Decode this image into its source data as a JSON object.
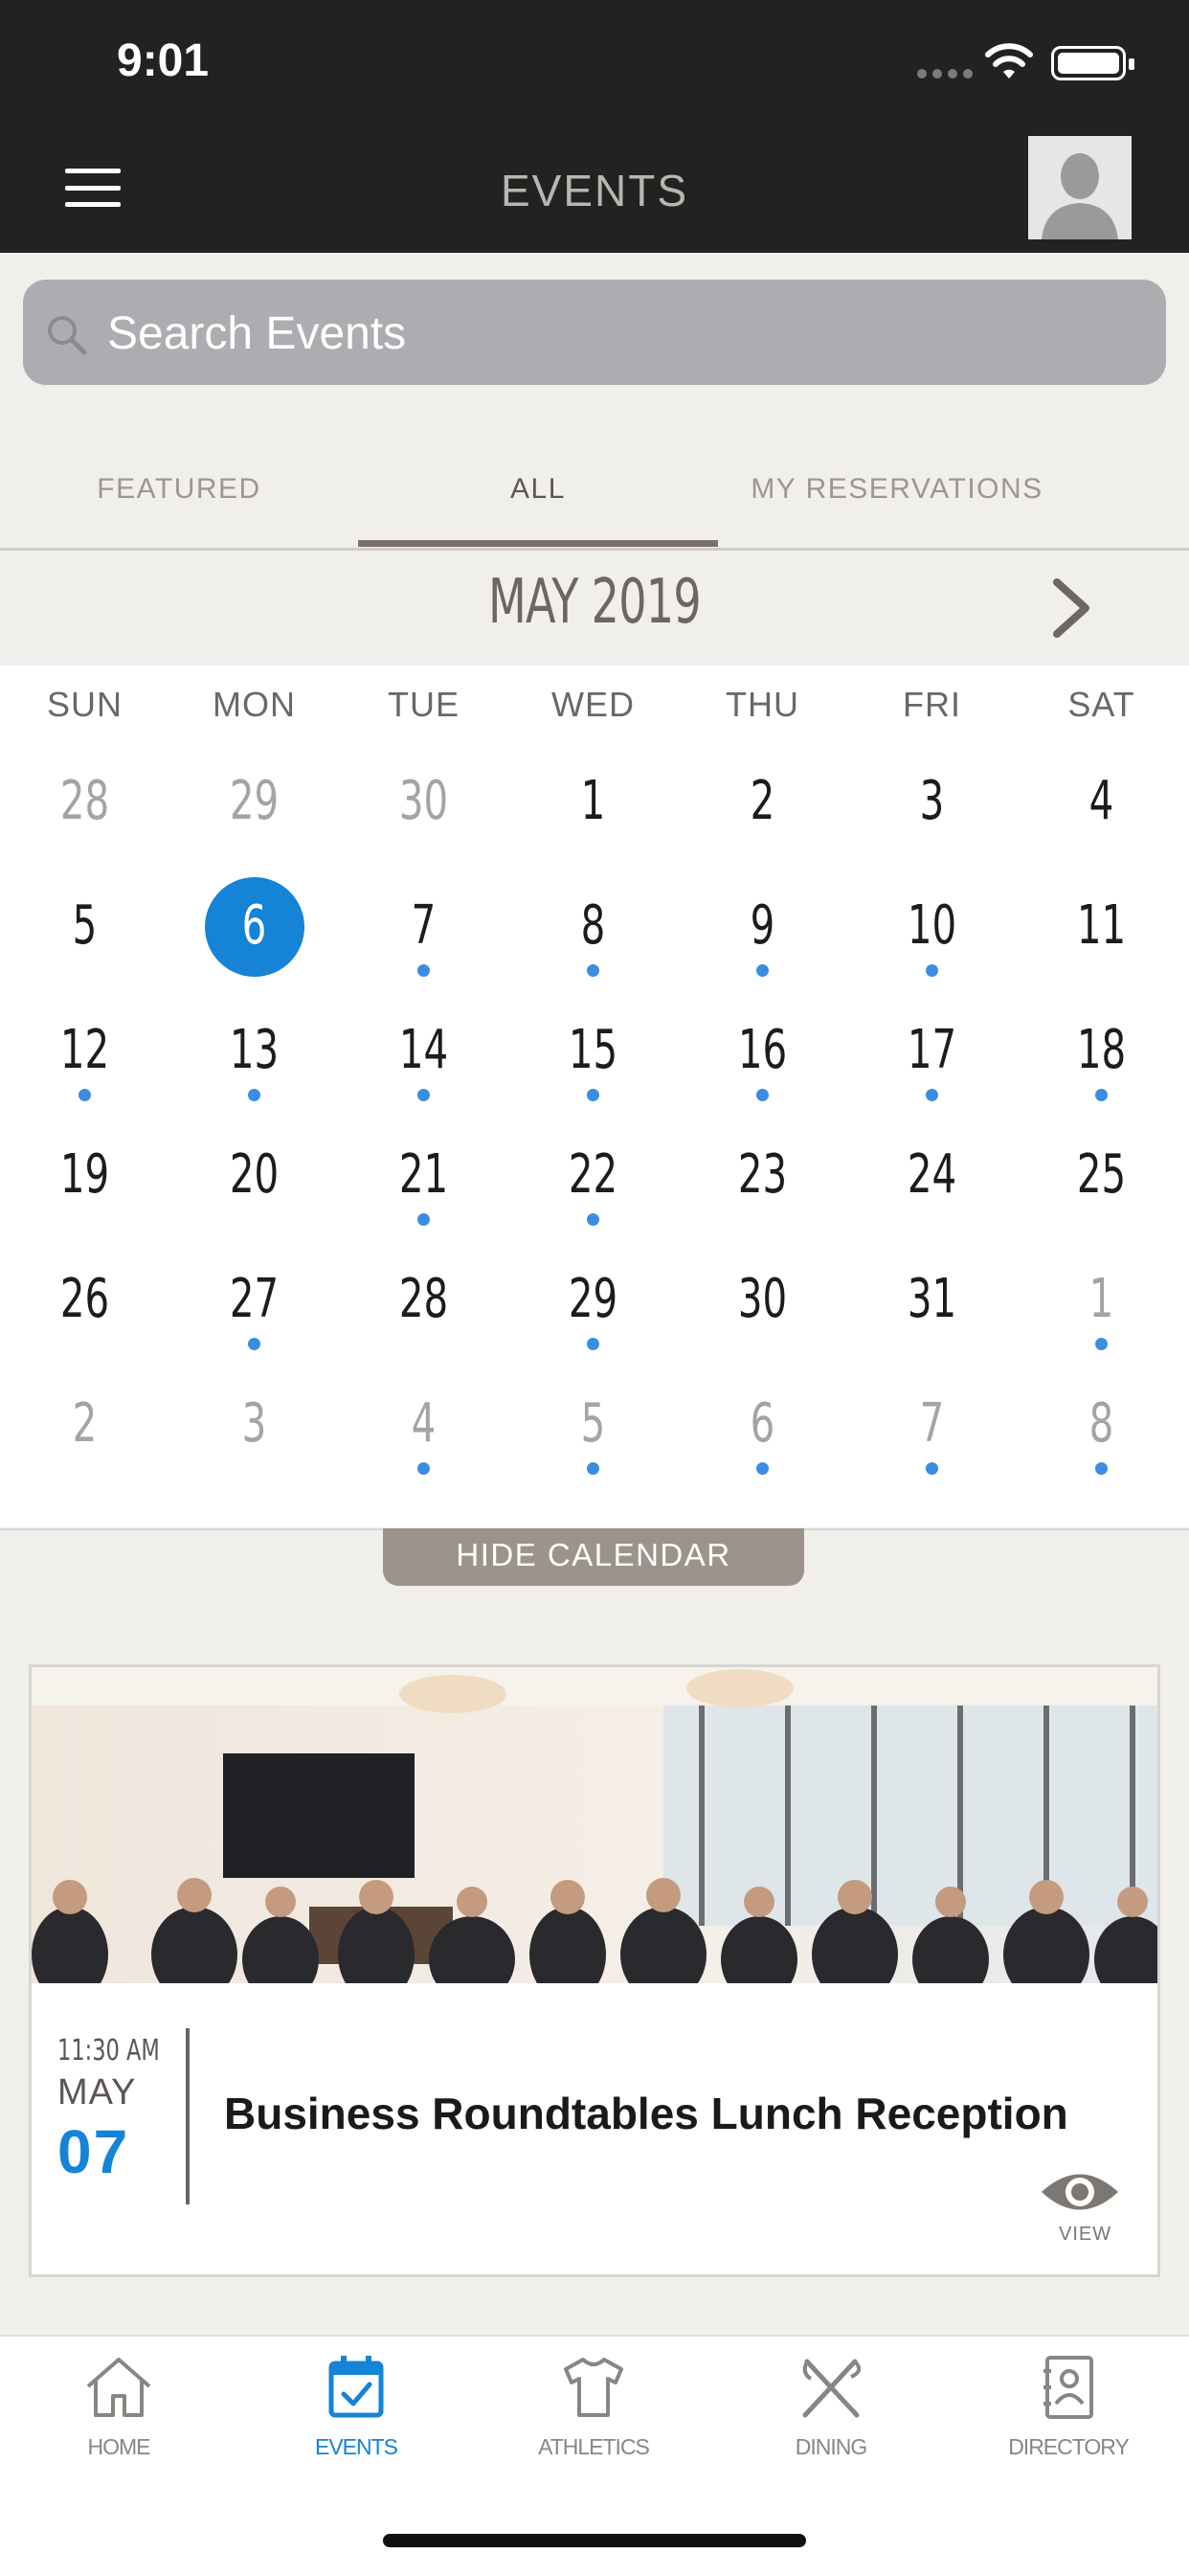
{
  "status_bar": {
    "time": "9:01"
  },
  "header": {
    "title": "EVENTS",
    "menu_icon": "hamburger-menu-icon",
    "avatar_icon": "user-avatar-icon"
  },
  "search": {
    "placeholder": "Search Events",
    "icon": "search-icon"
  },
  "tabs": [
    {
      "label": "FEATURED",
      "active": false
    },
    {
      "label": "ALL",
      "active": true
    },
    {
      "label": "MY RESERVATIONS",
      "active": false
    }
  ],
  "calendar": {
    "month_label": "MAY 2019",
    "weekdays": [
      "SUN",
      "MON",
      "TUE",
      "WED",
      "THU",
      "FRI",
      "SAT"
    ],
    "weeks": [
      [
        {
          "d": "28",
          "muted": true,
          "dot": false
        },
        {
          "d": "29",
          "muted": true,
          "dot": false
        },
        {
          "d": "30",
          "muted": true,
          "dot": false
        },
        {
          "d": "1",
          "muted": false,
          "dot": false
        },
        {
          "d": "2",
          "muted": false,
          "dot": false
        },
        {
          "d": "3",
          "muted": false,
          "dot": false
        },
        {
          "d": "4",
          "muted": false,
          "dot": false
        }
      ],
      [
        {
          "d": "5",
          "muted": false,
          "dot": false
        },
        {
          "d": "6",
          "muted": false,
          "dot": false,
          "selected": true
        },
        {
          "d": "7",
          "muted": false,
          "dot": true
        },
        {
          "d": "8",
          "muted": false,
          "dot": true
        },
        {
          "d": "9",
          "muted": false,
          "dot": true
        },
        {
          "d": "10",
          "muted": false,
          "dot": true
        },
        {
          "d": "11",
          "muted": false,
          "dot": false
        }
      ],
      [
        {
          "d": "12",
          "muted": false,
          "dot": true
        },
        {
          "d": "13",
          "muted": false,
          "dot": true
        },
        {
          "d": "14",
          "muted": false,
          "dot": true
        },
        {
          "d": "15",
          "muted": false,
          "dot": true
        },
        {
          "d": "16",
          "muted": false,
          "dot": true
        },
        {
          "d": "17",
          "muted": false,
          "dot": true
        },
        {
          "d": "18",
          "muted": false,
          "dot": true
        }
      ],
      [
        {
          "d": "19",
          "muted": false,
          "dot": false
        },
        {
          "d": "20",
          "muted": false,
          "dot": false
        },
        {
          "d": "21",
          "muted": false,
          "dot": true
        },
        {
          "d": "22",
          "muted": false,
          "dot": true
        },
        {
          "d": "23",
          "muted": false,
          "dot": false
        },
        {
          "d": "24",
          "muted": false,
          "dot": false
        },
        {
          "d": "25",
          "muted": false,
          "dot": false
        }
      ],
      [
        {
          "d": "26",
          "muted": false,
          "dot": false
        },
        {
          "d": "27",
          "muted": false,
          "dot": true
        },
        {
          "d": "28",
          "muted": false,
          "dot": false
        },
        {
          "d": "29",
          "muted": false,
          "dot": true
        },
        {
          "d": "30",
          "muted": false,
          "dot": false
        },
        {
          "d": "31",
          "muted": false,
          "dot": false
        },
        {
          "d": "1",
          "muted": true,
          "dot": true
        }
      ],
      [
        {
          "d": "2",
          "muted": true,
          "dot": false
        },
        {
          "d": "3",
          "muted": true,
          "dot": false
        },
        {
          "d": "4",
          "muted": true,
          "dot": true
        },
        {
          "d": "5",
          "muted": true,
          "dot": true
        },
        {
          "d": "6",
          "muted": true,
          "dot": true
        },
        {
          "d": "7",
          "muted": true,
          "dot": true
        },
        {
          "d": "8",
          "muted": true,
          "dot": true
        }
      ]
    ],
    "hide_label": "HIDE CALENDAR",
    "next_icon": "chevron-right-icon"
  },
  "event": {
    "time": "11:30 AM",
    "month": "MAY",
    "day": "07",
    "title": "Business Roundtables Lunch Reception",
    "view_label": "VIEW",
    "view_icon": "eye-icon"
  },
  "bottom_nav": [
    {
      "label": "HOME",
      "icon": "home-icon",
      "active": false
    },
    {
      "label": "EVENTS",
      "icon": "calendar-icon",
      "active": true
    },
    {
      "label": "ATHLETICS",
      "icon": "shirt-icon",
      "active": false
    },
    {
      "label": "DINING",
      "icon": "utensils-icon",
      "active": false
    },
    {
      "label": "DIRECTORY",
      "icon": "contacts-book-icon",
      "active": false
    }
  ],
  "colors": {
    "accent": "#1583d6",
    "header_bg": "#222222",
    "dot": "#3b8de3",
    "tab_active_underline": "#7a7168"
  }
}
